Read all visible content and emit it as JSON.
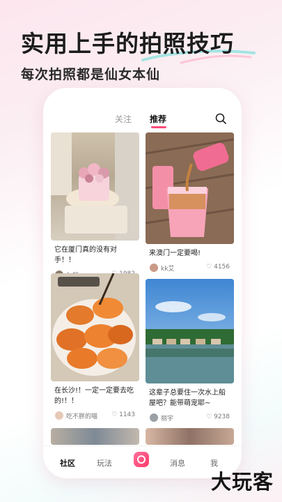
{
  "promo": {
    "headline": "实用上手的拍照技巧",
    "subline": "每次拍照都是仙女本仙"
  },
  "app": {
    "tabs": [
      {
        "label": "关注",
        "active": false
      },
      {
        "label": "推荐",
        "active": true
      }
    ],
    "posts": [
      {
        "title": "它在厦门真的没有对手！！",
        "user": "尔顿",
        "likes": "1982"
      },
      {
        "title": "来澳门一定要喝!",
        "user": "kk艾",
        "likes": "4156"
      },
      {
        "title": "在长沙!！一定一定要去吃的!！！",
        "user": "吃不胖的喵",
        "likes": "1143"
      },
      {
        "title": "这辈子总要住一次水上船屋吧？能带萌宠耶~",
        "user": "丽宇",
        "likes": "9238"
      }
    ],
    "bottom_nav": [
      {
        "label": "社区",
        "active": true
      },
      {
        "label": "玩法",
        "active": false
      },
      {
        "label": "消息",
        "active": false
      },
      {
        "label": "我",
        "active": false
      }
    ]
  },
  "brand": {
    "logo_text": "大玩客"
  },
  "colors": {
    "accent": "#ff4d7a",
    "text": "#1c1c1c"
  },
  "icons": [
    "search-icon",
    "heart-icon",
    "camera-icon",
    "sparkle-icon"
  ]
}
